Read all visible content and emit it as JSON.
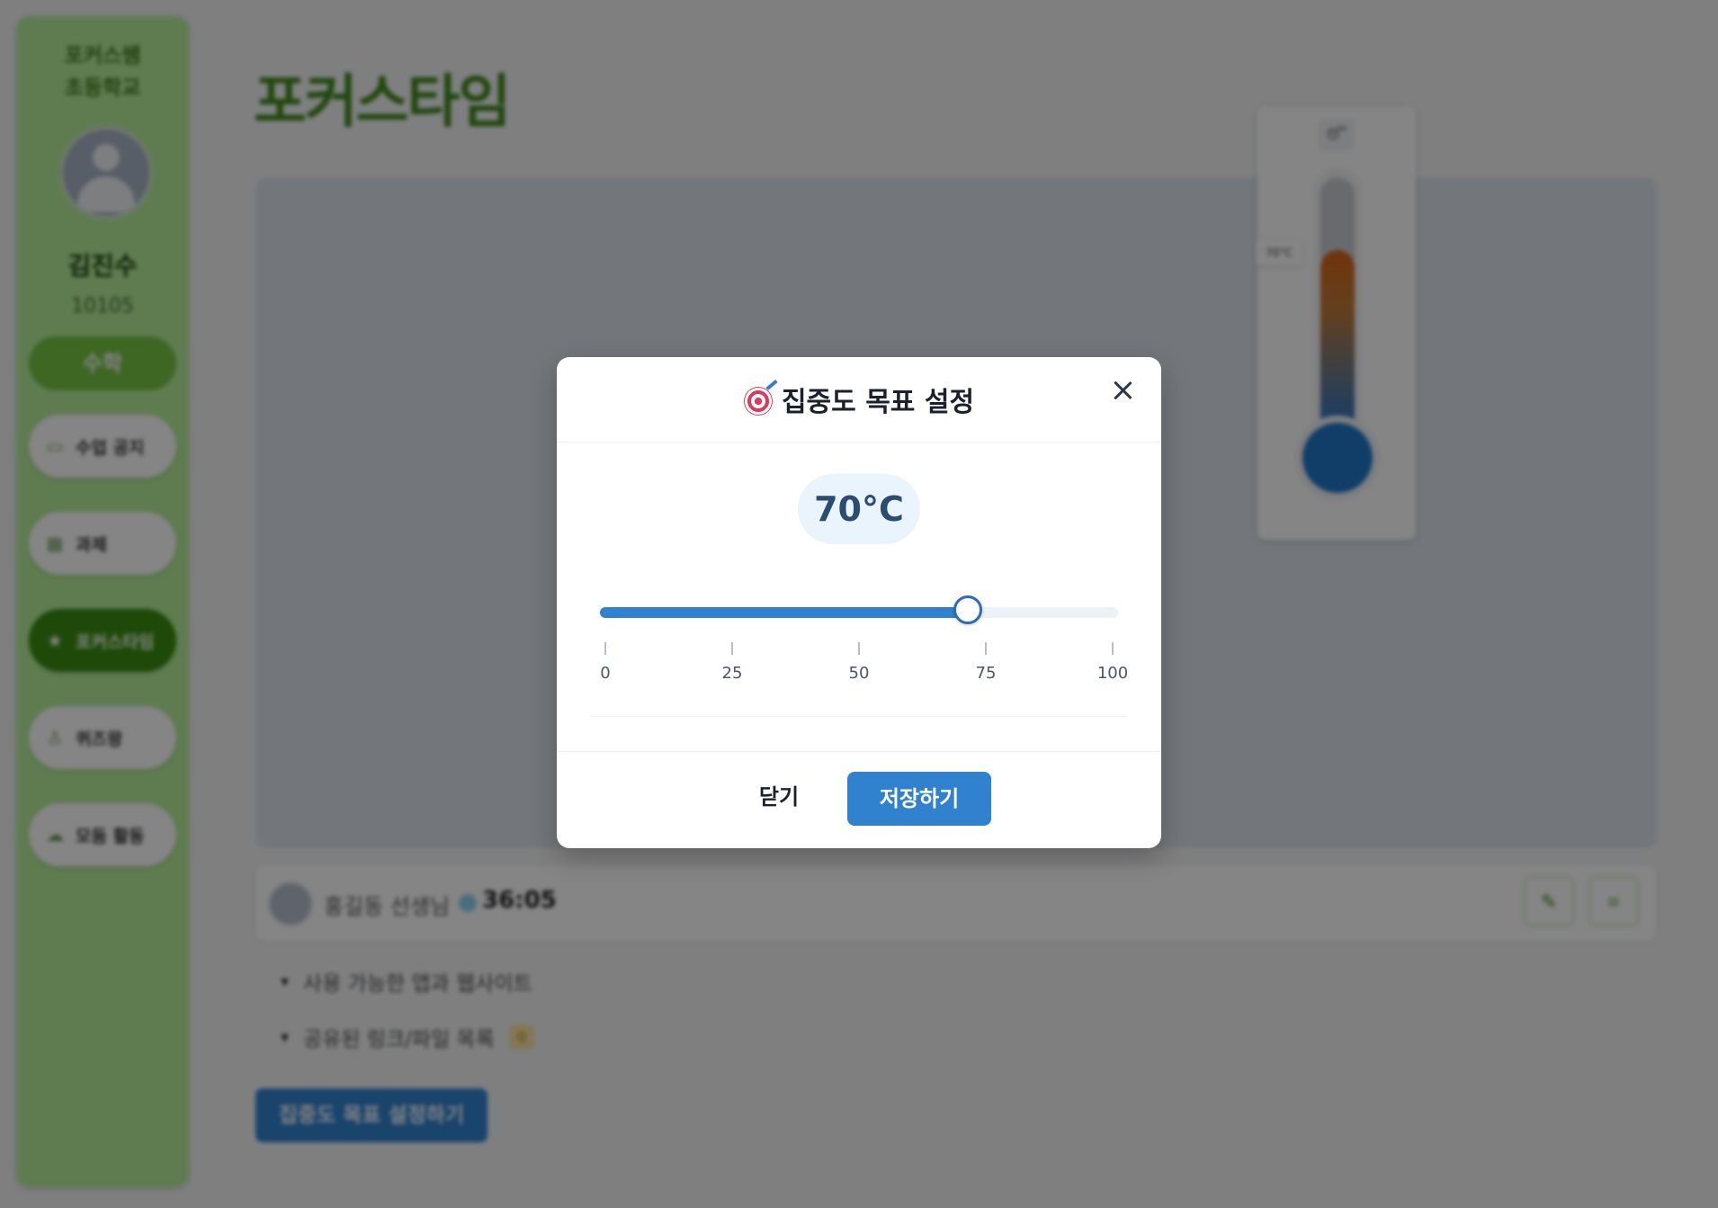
{
  "sidebar": {
    "school": "포커스쌤\n초등학교",
    "user_name": "김진수",
    "user_id": "10105",
    "subject": "수학",
    "nav": [
      {
        "label": "수업 공지",
        "icon": "monitor-icon"
      },
      {
        "label": "과제",
        "icon": "calendar-icon"
      },
      {
        "label": "포커스타임",
        "icon": "star-icon"
      },
      {
        "label": "퀴즈왕",
        "icon": "podium-icon"
      },
      {
        "label": "모둠 활동",
        "icon": "cloud-icon"
      }
    ]
  },
  "main": {
    "title": "포커스타임",
    "thermometer": {
      "tag": "😴",
      "marker": "70°C"
    },
    "teacher": {
      "name": "홍길동 선생님",
      "timer": "36:05"
    },
    "toolbar": {
      "edit_icon": "pencil-icon",
      "grid_icon": "grid-icon"
    },
    "accordions": [
      {
        "label": "사용 가능한 앱과 웹사이트",
        "badge": ""
      },
      {
        "label": "공유된 링크/파일 목록",
        "badge": "0"
      }
    ],
    "goal_button": "집중도 목표 설정하기"
  },
  "modal": {
    "title": "집중도 목표 설정",
    "title_icon": "target-icon",
    "value_display": "70°C",
    "slider": {
      "min": 0,
      "max": 100,
      "value": 71,
      "ticks": [
        "0",
        "25",
        "50",
        "75",
        "100"
      ]
    },
    "close_label": "닫기",
    "save_label": "저장하기"
  },
  "colors": {
    "sidebar": "#b5ee9a",
    "active_nav": "#3b8d12",
    "primary": "#3182ce"
  }
}
